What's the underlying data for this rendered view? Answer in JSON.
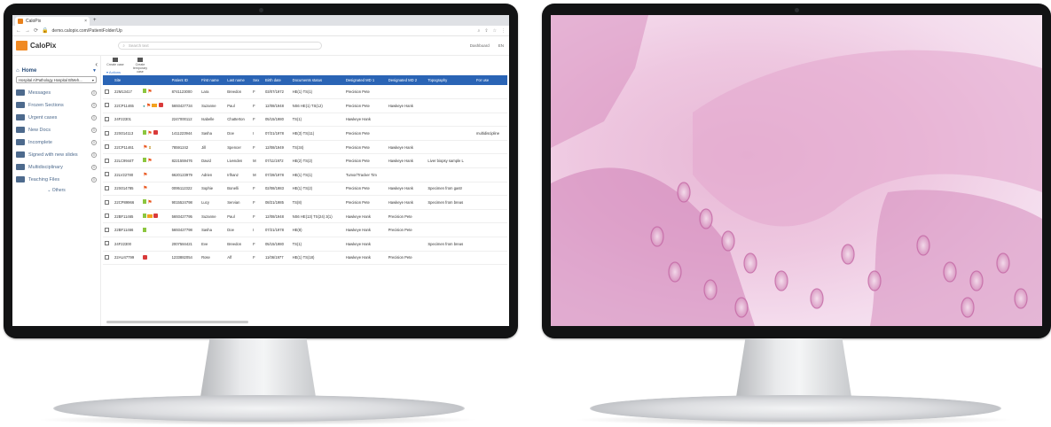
{
  "browser": {
    "tab_title": "CaloPix",
    "tab_close": "×",
    "new_tab": "+",
    "url": "demo.calopix.com/PatientFolder/Up"
  },
  "app": {
    "logo_text": "CaloPix",
    "search_placeholder": "Search text",
    "dashboard": "Dashboard",
    "language": "EN"
  },
  "toolbar": {
    "create_case": "Create case",
    "create_temporary_case": "Create temporary case"
  },
  "filter_label": "Actions",
  "sidebar": {
    "home": "Home",
    "hospital": "Hospital A/Pathology Hospital B/Meh...",
    "items": [
      {
        "label": "Messages",
        "count": "0"
      },
      {
        "label": "Frozen Sections",
        "count": "0"
      },
      {
        "label": "Urgent cases",
        "count": "0"
      },
      {
        "label": "New Docs",
        "count": "0"
      },
      {
        "label": "Incomplete",
        "count": "0"
      },
      {
        "label": "Signed with new slides",
        "count": "0"
      },
      {
        "label": "Multidisciplinary",
        "count": "0"
      },
      {
        "label": "Teaching Files",
        "count": "0"
      }
    ],
    "others": "Others"
  },
  "table": {
    "columns": [
      "Site",
      "Patient ID",
      "First name",
      "Last name",
      "Sex",
      "Birth date",
      "Documents status",
      "Designated MD 1",
      "Designated MD 2",
      "Topography",
      "For use"
    ],
    "rows": [
      {
        "site": "22M13417",
        "pid": "8741123000",
        "first": "Lara",
        "last": "Breedon",
        "sex": "F",
        "birth": "03/07/1972",
        "docs": "HE(1) TS(1)",
        "md1": "Precision Pete",
        "md2": "",
        "topo": "",
        "use": "",
        "icons": [
          "doc",
          "flag"
        ]
      },
      {
        "site": "22CP11465",
        "pid": "5693427734",
        "first": "Suzanne",
        "last": "Paul",
        "sex": "F",
        "birth": "12/08/1948",
        "docs": "NS6 HE(1) TS(12)",
        "md1": "Precision Pete",
        "md2": "Hawkeye Hank",
        "topo": "",
        "use": "",
        "icons": [
          "dot",
          "flag",
          "fold",
          "alert"
        ]
      },
      {
        "site": "24F22301",
        "pid": "2247000112",
        "first": "Isabelle",
        "last": "Chatterton",
        "sex": "F",
        "birth": "05/15/1980",
        "docs": "TS(1)",
        "md1": "Hawkeye Hank",
        "md2": "",
        "topo": "",
        "use": "",
        "icons": []
      },
      {
        "site": "22S014113",
        "pid": "1411223944",
        "first": "Sasha",
        "last": "Doe",
        "sex": "I",
        "birth": "07/21/1978",
        "docs": "HE(3) TS(11)",
        "md1": "Precision Pete",
        "md2": "",
        "topo": "",
        "use": "multidiscipline",
        "icons": [
          "doc",
          "flag",
          "alert"
        ]
      },
      {
        "site": "22CP11461",
        "pid": "78591242",
        "first": "Jill",
        "last": "Spencer",
        "sex": "F",
        "birth": "12/08/1949",
        "docs": "TS(34)",
        "md1": "Precision Pete",
        "md2": "Hawkeye Hank",
        "topo": "",
        "use": "",
        "icons": [
          "flag",
          "hglass"
        ]
      },
      {
        "site": "22LC9944T",
        "pid": "8221559476",
        "first": "David",
        "last": "Livenden",
        "sex": "M",
        "birth": "07/11/1972",
        "docs": "HE(2) TS(2)",
        "md1": "Precision Pete",
        "md2": "Hawkeye Hank",
        "topo": "Liver biopsy sample L",
        "use": "",
        "icons": [
          "doc",
          "flag"
        ]
      },
      {
        "site": "22LV22780",
        "pid": "6620123979",
        "first": "Adrien",
        "last": "Irlhanz",
        "sex": "M",
        "birth": "07/28/1978",
        "docs": "HE(1) TS(1)",
        "md1": "Tumor/Tracker Tim",
        "md2": "",
        "topo": "",
        "use": "",
        "icons": [
          "flag"
        ]
      },
      {
        "site": "22S014785",
        "pid": "0095112322",
        "first": "Sophie",
        "last": "Bonelli",
        "sex": "F",
        "birth": "02/08/1983",
        "docs": "HE(1) TS(2)",
        "md1": "Precision Pete",
        "md2": "Hawkeye Hank",
        "topo": "Specimen from gastr",
        "use": "",
        "icons": [
          "flag"
        ]
      },
      {
        "site": "22CP89966",
        "pid": "9015524798",
        "first": "Lucy",
        "last": "Servian",
        "sex": "F",
        "birth": "08/21/1985",
        "docs": "TS(8)",
        "md1": "Precision Pete",
        "md2": "Hawkeye Hank",
        "topo": "Specimen from breas",
        "use": "",
        "icons": [
          "doc",
          "flag"
        ]
      },
      {
        "site": "22BF11465",
        "pid": "5693427795",
        "first": "Suzanne",
        "last": "Paul",
        "sex": "F",
        "birth": "12/08/1948",
        "docs": "NS6 HE(13) TS(24) 3(1)",
        "md1": "Hawkeye Hank",
        "md2": "Precision Pete",
        "topo": "",
        "use": "",
        "icons": [
          "doc",
          "fold",
          "alert"
        ]
      },
      {
        "site": "22BF11466",
        "pid": "5693427798",
        "first": "Sasha",
        "last": "Doe",
        "sex": "I",
        "birth": "07/21/1978",
        "docs": "HE(8)",
        "md1": "Hawkeye Hank",
        "md2": "Precision Pete",
        "topo": "",
        "use": "",
        "icons": [
          "doc"
        ]
      },
      {
        "site": "24F22300",
        "pid": "2007584421",
        "first": "Eve",
        "last": "Breedon",
        "sex": "F",
        "birth": "05/15/1980",
        "docs": "TS(1)",
        "md1": "Hawkeye Hank",
        "md2": "",
        "topo": "Specimen from breas",
        "use": "",
        "icons": []
      },
      {
        "site": "22AU47799",
        "pid": "1233882054",
        "first": "Rose",
        "last": "Alf",
        "sex": "F",
        "birth": "11/06/1977",
        "docs": "HE(1) TS(18)",
        "md1": "Hawkeye Hank",
        "md2": "Precision Pete",
        "topo": "",
        "use": "",
        "icons": [
          "alert"
        ]
      }
    ]
  }
}
